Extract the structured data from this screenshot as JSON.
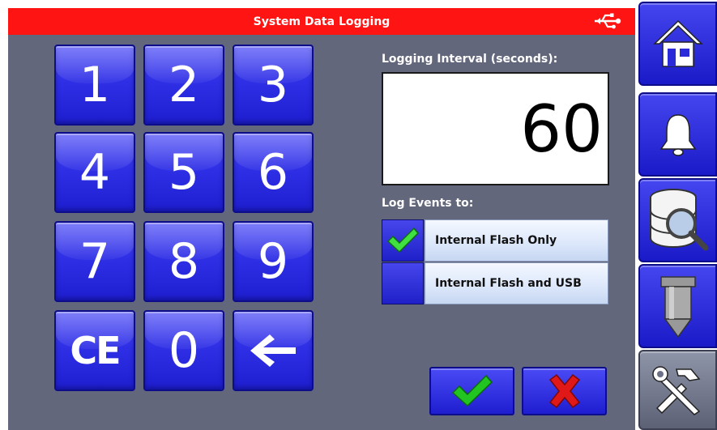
{
  "title": "System Data Logging",
  "keypad": {
    "keys": [
      "1",
      "2",
      "3",
      "4",
      "5",
      "6",
      "7",
      "8",
      "9",
      "CE",
      "0"
    ],
    "backspace_icon": "left-arrow-icon"
  },
  "interval": {
    "label": "Logging Interval (seconds):",
    "value": "60"
  },
  "log_events": {
    "label": "Log Events to:",
    "options": [
      {
        "label": "Internal Flash Only",
        "selected": true
      },
      {
        "label": "Internal Flash and USB",
        "selected": false
      }
    ]
  },
  "actions": {
    "confirm_icon": "checkmark-icon",
    "cancel_icon": "x-icon"
  },
  "sidebar": {
    "items": [
      {
        "icon": "home-icon"
      },
      {
        "icon": "bell-icon"
      },
      {
        "icon": "database-search-icon"
      },
      {
        "icon": "nozzle-icon"
      },
      {
        "icon": "tools-icon",
        "active": true
      }
    ]
  },
  "colors": {
    "title_bar": "#ff1414",
    "background": "#62677c",
    "key_blue": "#2f2fe6",
    "check_green": "#22c422",
    "cancel_red": "#e01818"
  }
}
